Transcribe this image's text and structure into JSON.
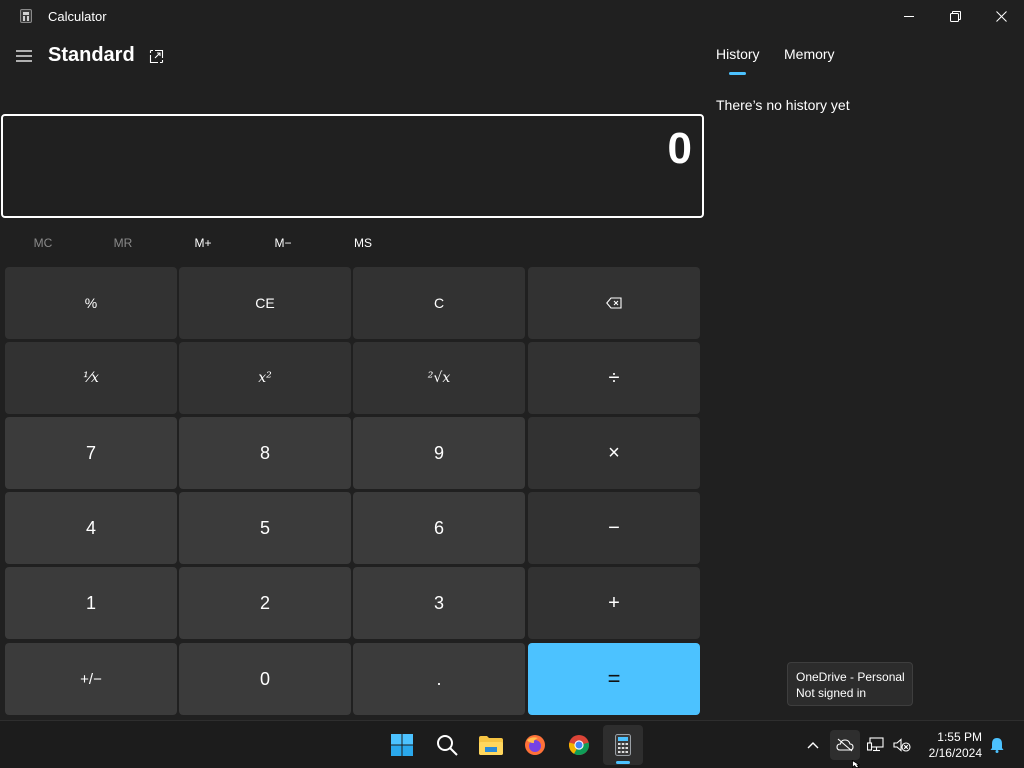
{
  "window": {
    "title": "Calculator",
    "icons": {
      "app": "calculator-icon",
      "minimize": "minimize-icon",
      "maximize": "restore-icon",
      "close": "close-icon"
    }
  },
  "header": {
    "mode": "Standard",
    "menu_icon": "hamburger-icon",
    "keep_on_top_icon": "keep-on-top-icon"
  },
  "display": {
    "value": "0"
  },
  "memory": {
    "buttons": [
      {
        "label": "MC",
        "enabled": false
      },
      {
        "label": "MR",
        "enabled": false
      },
      {
        "label": "M+",
        "enabled": true
      },
      {
        "label": "M−",
        "enabled": true
      },
      {
        "label": "MS",
        "enabled": true
      }
    ]
  },
  "keypad": {
    "percent": "%",
    "clear_entry": "CE",
    "clear": "C",
    "backspace_icon": "backspace-icon",
    "reciprocal": "⅟x",
    "square": "x²",
    "sqrt": "²√x",
    "divide": "÷",
    "seven": "7",
    "eight": "8",
    "nine": "9",
    "multiply": "×",
    "four": "4",
    "five": "5",
    "six": "6",
    "subtract": "−",
    "one": "1",
    "two": "2",
    "three": "3",
    "add": "+",
    "negate": "+/−",
    "zero": "0",
    "decimal": ".",
    "equals": "="
  },
  "side_panel": {
    "tabs": [
      {
        "label": "History",
        "selected": true
      },
      {
        "label": "Memory",
        "selected": false
      }
    ],
    "empty_message": "There’s no history yet"
  },
  "tooltip": {
    "line1": "OneDrive - Personal",
    "line2": "Not signed in"
  },
  "taskbar": {
    "apps": [
      "start-icon",
      "search-icon",
      "file-explorer-icon",
      "firefox-icon",
      "chrome-icon",
      "calculator-icon"
    ],
    "tray": [
      "chevron-up-icon",
      "onedrive-icon",
      "network-icon",
      "volume-muted-icon",
      "notification-icon"
    ],
    "time": "1:55 PM",
    "date": "2/16/2024"
  },
  "colors": {
    "accent": "#4cc2ff",
    "background": "#202020",
    "key": "#3b3b3b",
    "func_key": "#323232",
    "taskbar": "#1c1c1c"
  }
}
